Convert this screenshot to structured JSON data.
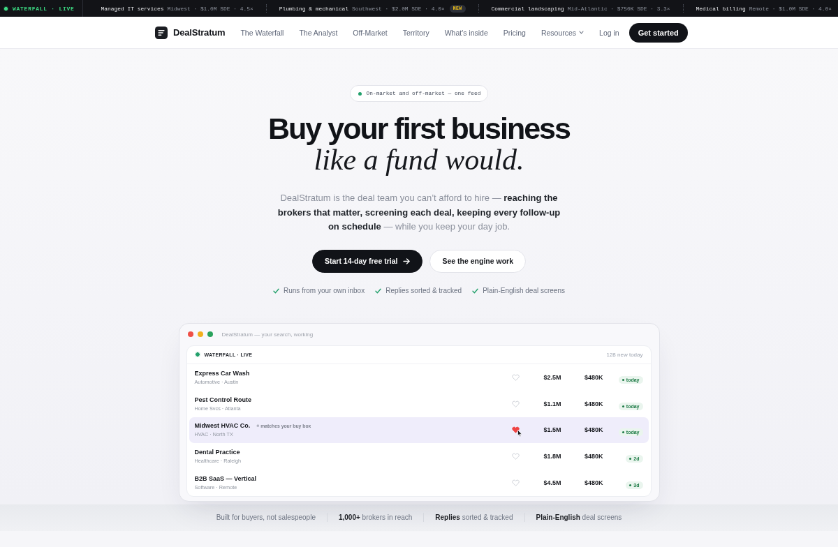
{
  "ticker": {
    "label": "WATERFALL · LIVE",
    "items": [
      {
        "name": "Managed IT services",
        "detail": "Midwest · $1.0M SDE · 4.5×"
      },
      {
        "name": "Plumbing & mechanical",
        "detail": "Southwest · $2.0M SDE · 4.0×",
        "badge": "NEW"
      },
      {
        "name": "Commercial landscaping",
        "detail": "Mid-Atlantic · $750K SDE · 3.3×"
      },
      {
        "name": "Medical billing",
        "detail": "Remote · $1.0M SDE · 4.0×"
      }
    ]
  },
  "nav": {
    "brand": "DealStratum",
    "links": [
      {
        "label": "The Waterfall",
        "kind": "link"
      },
      {
        "label": "The Analyst",
        "kind": "link"
      },
      {
        "label": "Off-Market",
        "kind": "link"
      },
      {
        "label": "Territory",
        "kind": "link"
      },
      {
        "label": "What's inside",
        "kind": "link"
      },
      {
        "label": "Pricing",
        "kind": "link"
      },
      {
        "label": "Resources",
        "kind": "dropdown"
      }
    ],
    "login": "Log in",
    "cta": "Get started"
  },
  "hero": {
    "eyebrow": "On-market and off-market — one feed",
    "headline": "Buy your first business",
    "headline_accent": "like a fund would.",
    "lede": "DealStratum is the deal team you can’t afford to hire — **reaching the brokers that matter, screening each deal, keeping every follow-up on schedule** — while you keep your day job.",
    "primary_button": "Start 14-day free trial",
    "secondary_button": "See the engine work",
    "checks": [
      "Runs from your own inbox",
      "Replies sorted & tracked",
      "Plain-English deal screens"
    ]
  },
  "preview": {
    "window_title": "DealStratum — your search, working",
    "feed_label": "WATERFALL · LIVE",
    "feed_count": "128 new today",
    "rows": [
      {
        "name": "Express Car Wash",
        "meta": "Automotive · Austin",
        "saved": false,
        "highlighted": false,
        "price": "$2.5M",
        "cash_flow": "$480K",
        "age": "today"
      },
      {
        "name": "Pest Control Route",
        "meta": "Home Svcs · Atlanta",
        "saved": false,
        "highlighted": false,
        "price": "$1.1M",
        "cash_flow": "$480K",
        "age": "today"
      },
      {
        "name": "Midwest HVAC Co.",
        "tag": "+ matches your buy box",
        "meta": "HVAC · North TX",
        "saved": true,
        "highlighted": true,
        "price": "$1.5M",
        "cash_flow": "$480K",
        "age": "today"
      },
      {
        "name": "Dental Practice",
        "meta": "Healthcare · Raleigh",
        "saved": false,
        "highlighted": false,
        "price": "$1.8M",
        "cash_flow": "$480K",
        "age": "2d"
      },
      {
        "name": "B2B SaaS — Vertical",
        "meta": "Software · Remote",
        "saved": false,
        "highlighted": false,
        "price": "$4.5M",
        "cash_flow": "$480K",
        "age": "3d"
      }
    ]
  },
  "proof": [
    "Built for buyers, not salespeople",
    "**1,000+** brokers in reach",
    "**Replies** sorted & tracked",
    "**Plain-English** deal screens"
  ]
}
